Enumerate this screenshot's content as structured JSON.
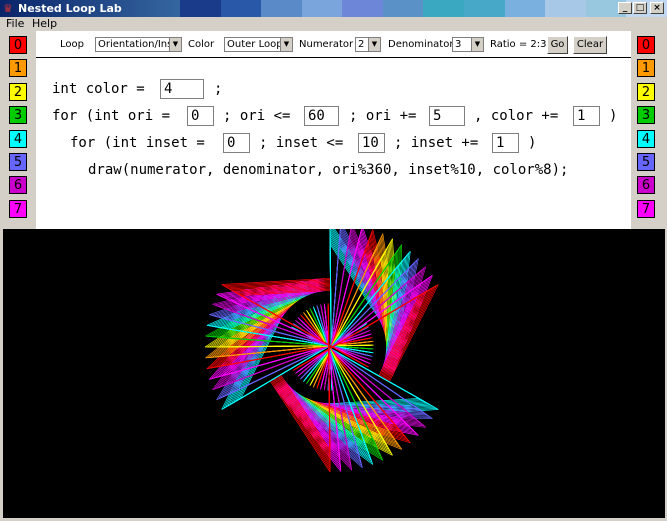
{
  "window": {
    "title": "Nested Loop Lab"
  },
  "menu": {
    "file": "File",
    "help": "Help"
  },
  "color_buttons": [
    {
      "label": "0",
      "color": "#ff0000",
      "text": "#000000"
    },
    {
      "label": "1",
      "color": "#ff9900",
      "text": "#000000"
    },
    {
      "label": "2",
      "color": "#ffff00",
      "text": "#000000"
    },
    {
      "label": "3",
      "color": "#00cc00",
      "text": "#000000"
    },
    {
      "label": "4",
      "color": "#00ffff",
      "text": "#000000"
    },
    {
      "label": "5",
      "color": "#6666ff",
      "text": "#000000"
    },
    {
      "label": "6",
      "color": "#cc00cc",
      "text": "#000000"
    },
    {
      "label": "7",
      "color": "#ff00ff",
      "text": "#000000"
    }
  ],
  "toolbar": {
    "loop_label": "Loop",
    "loop_value": "Orientation/Inset",
    "color_label": "Color",
    "color_value": "Outer Loop",
    "numerator_label": "Numerator",
    "numerator_value": "2",
    "denominator_label": "Denominator",
    "denominator_value": "3",
    "ratio_text": "Ratio = 2:3",
    "go_label": "Go",
    "clear_label": "Clear"
  },
  "code": {
    "line1_a": "int color =",
    "color_value": "4",
    "line1_b": ";",
    "line2_a": "for (int ori =",
    "ori_start": "0",
    "line2_b": "; ori <=",
    "ori_end": "60",
    "line2_c": "; ori +=",
    "ori_step": "5",
    "line2_d": ", color +=",
    "color_step": "1",
    "line2_e": ")",
    "line3_a": "for (int inset =",
    "inset_start": "0",
    "line3_b": "; inset <=",
    "inset_end": "10",
    "line3_c": "; inset +=",
    "inset_step": "1",
    "line3_d": ")",
    "line4": "draw(numerator, denominator, ori%360, inset%10, color%8);"
  },
  "palette": [
    "#ff0000",
    "#ff9900",
    "#ffff00",
    "#00cc00",
    "#00ffff",
    "#6666ff",
    "#cc00cc",
    "#ff00ff"
  ]
}
